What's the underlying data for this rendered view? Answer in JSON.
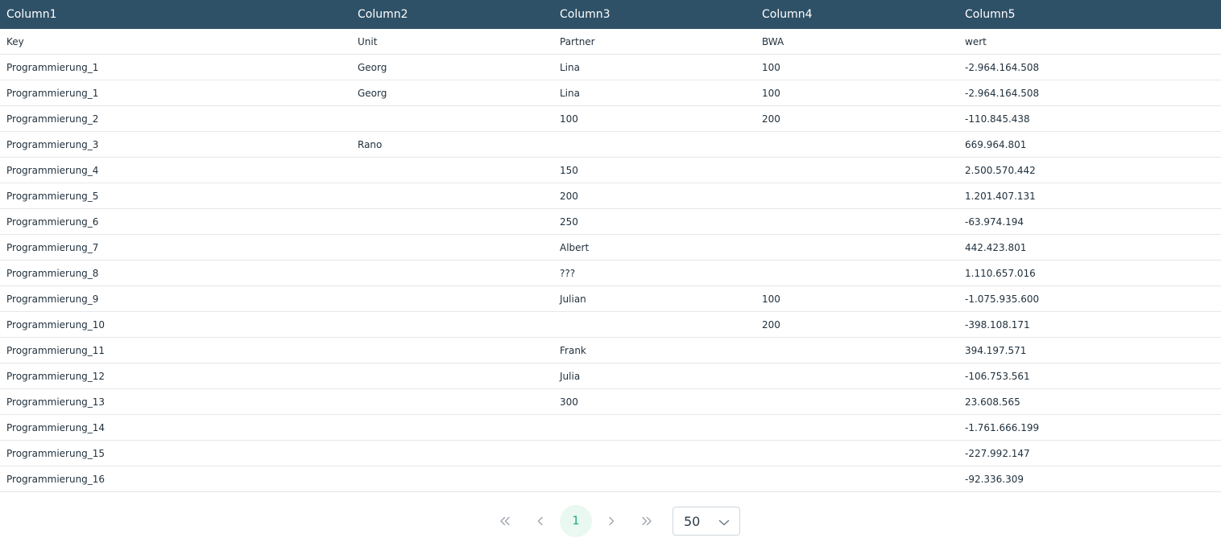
{
  "table": {
    "columns": [
      "Column1",
      "Column2",
      "Column3",
      "Column4",
      "Column5"
    ],
    "rows": [
      [
        "Key",
        "Unit",
        "Partner",
        "BWA",
        "wert"
      ],
      [
        "Programmierung_1",
        "Georg",
        "Lina",
        "100",
        "-2.964.164.508"
      ],
      [
        "Programmierung_1",
        "Georg",
        "Lina",
        "100",
        "-2.964.164.508"
      ],
      [
        "Programmierung_2",
        "",
        "100",
        "200",
        "-110.845.438"
      ],
      [
        "Programmierung_3",
        "Rano",
        "",
        "",
        "669.964.801"
      ],
      [
        "Programmierung_4",
        "",
        "150",
        "",
        "2.500.570.442"
      ],
      [
        "Programmierung_5",
        "",
        "200",
        "",
        "1.201.407.131"
      ],
      [
        "Programmierung_6",
        "",
        "250",
        "",
        "-63.974.194"
      ],
      [
        "Programmierung_7",
        "",
        "Albert",
        "",
        "442.423.801"
      ],
      [
        "Programmierung_8",
        "",
        "???",
        "",
        "1.110.657.016"
      ],
      [
        "Programmierung_9",
        "",
        "Julian",
        "100",
        "-1.075.935.600"
      ],
      [
        "Programmierung_10",
        "",
        "",
        "200",
        "-398.108.171"
      ],
      [
        "Programmierung_11",
        "",
        "Frank",
        "",
        "394.197.571"
      ],
      [
        "Programmierung_12",
        "",
        "Julia",
        "",
        "-106.753.561"
      ],
      [
        "Programmierung_13",
        "",
        "300",
        "",
        "23.608.565"
      ],
      [
        "Programmierung_14",
        "",
        "",
        "",
        "-1.761.666.199"
      ],
      [
        "Programmierung_15",
        "",
        "",
        "",
        "-227.992.147"
      ],
      [
        "Programmierung_16",
        "",
        "",
        "",
        "-92.336.309"
      ]
    ]
  },
  "pagination": {
    "first_icon": "double-chevron-left-icon",
    "prev_icon": "chevron-left-icon",
    "current_page": "1",
    "next_icon": "chevron-right-icon",
    "last_icon": "double-chevron-right-icon",
    "rows_per_page": "50",
    "rows_options": [
      "50"
    ]
  },
  "colors": {
    "header_bg": "#2f5167",
    "header_text": "#ffffff",
    "active_page_bg": "#e9f8f1",
    "active_page_text": "#18a772",
    "row_border": "#e5e7eb"
  }
}
